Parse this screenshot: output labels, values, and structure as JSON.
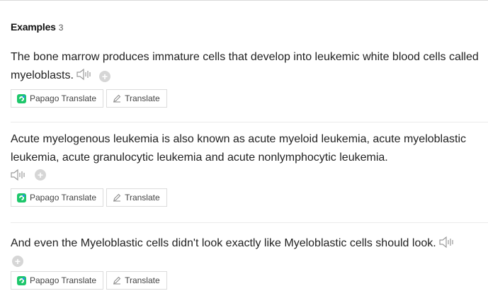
{
  "section": {
    "title": "Examples",
    "count": "3"
  },
  "examples": [
    {
      "sentence": "The bone marrow produces immature cells that develop into leukemic white blood cells called myeloblasts.",
      "papago_label": "Papago Translate",
      "translate_label": "Translate"
    },
    {
      "sentence": "Acute myelogenous leukemia is also known as acute myeloid leukemia, acute myeloblastic leukemia, acute granulocytic leukemia and acute nonlymphocytic leukemia.",
      "papago_label": "Papago Translate",
      "translate_label": "Translate"
    },
    {
      "sentence": "And even the Myeloblastic cells didn't look exactly like Myeloblastic cells should look.",
      "papago_label": "Papago Translate",
      "translate_label": "Translate"
    }
  ],
  "icons": {
    "speaker": "speaker-icon",
    "add": "plus-circle-icon",
    "papago": "papago-logo-icon",
    "pencil": "pencil-icon"
  },
  "colors": {
    "papago_green": "#1ec76b",
    "papago_blue": "#2d8cf0",
    "icon_gray": "#9a9a9a",
    "plus_gray": "#d6d6d6"
  }
}
